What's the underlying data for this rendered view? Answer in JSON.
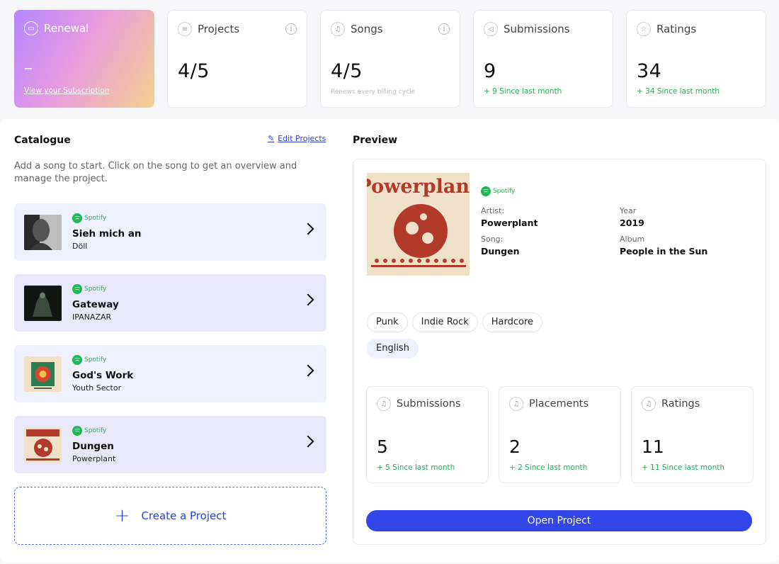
{
  "stats": {
    "renewal": {
      "label": "Renewal",
      "value": "–",
      "link": "View your Subscription",
      "icon": "calendar-icon"
    },
    "projects": {
      "label": "Projects",
      "value": "4/5",
      "icon": "document-icon"
    },
    "songs": {
      "label": "Songs",
      "value": "4/5",
      "sub": "Renews every billing cycle",
      "icon": "music-note-icon"
    },
    "submissions": {
      "label": "Submissions",
      "value": "9",
      "sub": "+ 9 Since last month",
      "icon": "send-icon"
    },
    "ratings": {
      "label": "Ratings",
      "value": "34",
      "sub": "+ 34 Since last month",
      "icon": "star-icon"
    }
  },
  "catalogue": {
    "title": "Catalogue",
    "edit_label": "Edit Projects",
    "description": "Add a song to start. Click on the song to get an overview and manage the project.",
    "songs": [
      {
        "source": "Spotify",
        "title": "Sieh mich an",
        "artist": "Döll"
      },
      {
        "source": "Spotify",
        "title": "Gateway",
        "artist": "IPANAZAR"
      },
      {
        "source": "Spotify",
        "title": "God's Work",
        "artist": "Youth Sector"
      },
      {
        "source": "Spotify",
        "title": "Dungen",
        "artist": "Powerplant"
      }
    ],
    "create_label": "Create a Project"
  },
  "preview": {
    "title": "Preview",
    "source": "Spotify",
    "artist_label": "Artist:",
    "artist": "Powerplant",
    "song_label": "Song:",
    "song": "Dungen",
    "year_label": "Year",
    "year": "2019",
    "album_label": "Album",
    "album": "People in the Sun",
    "cover_text": "Powerplant",
    "tags": [
      "Punk",
      "Indie Rock",
      "Hardcore"
    ],
    "language": "English",
    "stats": [
      {
        "label": "Submissions",
        "value": "5",
        "sub": "+ 5 Since last month"
      },
      {
        "label": "Placements",
        "value": "2",
        "sub": "+ 2 Since last month"
      },
      {
        "label": "Ratings",
        "value": "11",
        "sub": "+ 11 Since last month"
      }
    ],
    "open_label": "Open Project"
  },
  "colors": {
    "accent": "#3245e6",
    "positive": "#22b05a",
    "spotify": "#1db954",
    "item_bg": "#f0f1ff"
  }
}
